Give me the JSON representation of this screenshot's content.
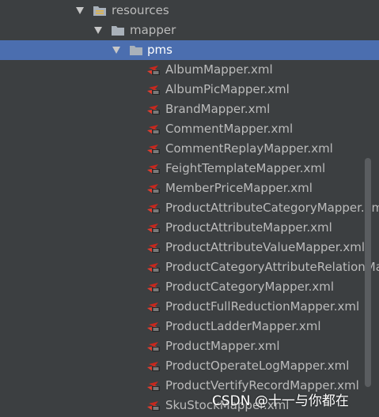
{
  "tree": {
    "resources_label": "resources",
    "mapper_label": "mapper",
    "pms_label": "pms",
    "files": [
      "AlbumMapper.xml",
      "AlbumPicMapper.xml",
      "BrandMapper.xml",
      "CommentMapper.xml",
      "CommentReplayMapper.xml",
      "FeightTemplateMapper.xml",
      "MemberPriceMapper.xml",
      "ProductAttributeCategoryMapper.xml",
      "ProductAttributeMapper.xml",
      "ProductAttributeValueMapper.xml",
      "ProductCategoryAttributeRelationMapper.xml",
      "ProductCategoryMapper.xml",
      "ProductFullReductionMapper.xml",
      "ProductLadderMapper.xml",
      "ProductMapper.xml",
      "ProductOperateLogMapper.xml",
      "ProductVertifyRecordMapper.xml",
      "SkuStockMapper.xml"
    ]
  },
  "watermark": {
    "text": "CSDN @十一与你都在"
  },
  "colors": {
    "background": "#3c3f41",
    "selection": "#4b6eaf",
    "text": "#bbbbbb",
    "folder": "#a9b1ba",
    "xml_icon_red": "#c7281e"
  },
  "icons": {
    "expand": "chevron-down-icon",
    "folder": "folder-icon",
    "resources_folder": "resources-folder-icon",
    "xml_file": "xml-file-icon"
  }
}
